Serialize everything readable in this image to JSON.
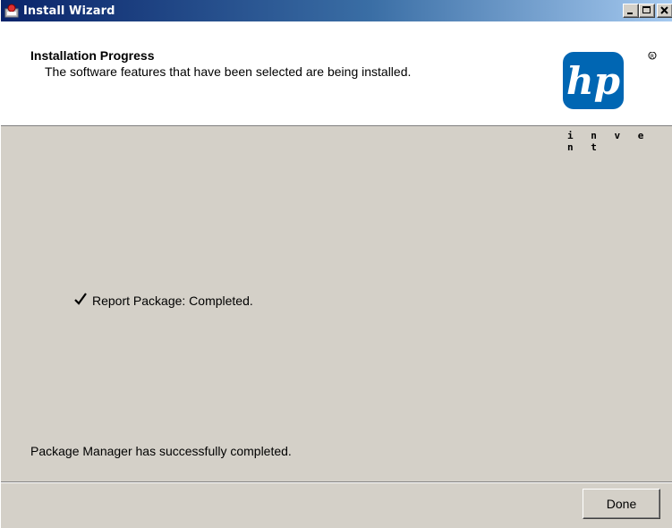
{
  "window": {
    "title": "Install Wizard",
    "app_icon": "install-wizard-icon",
    "controls": {
      "minimize": "minimize-icon",
      "maximize": "maximize-icon",
      "close": "close-icon"
    }
  },
  "header": {
    "title": "Installation Progress",
    "subtitle": "The software features that have been selected are being installed.",
    "logo": {
      "text": "hp",
      "tagline": "i n v e n t",
      "brand_color": "#0066b3"
    }
  },
  "progress": {
    "items": [
      {
        "icon": "checkmark-icon",
        "label": "Report Package: Completed."
      }
    ],
    "summary": "Package Manager has successfully completed."
  },
  "footer": {
    "done_label": "Done"
  }
}
